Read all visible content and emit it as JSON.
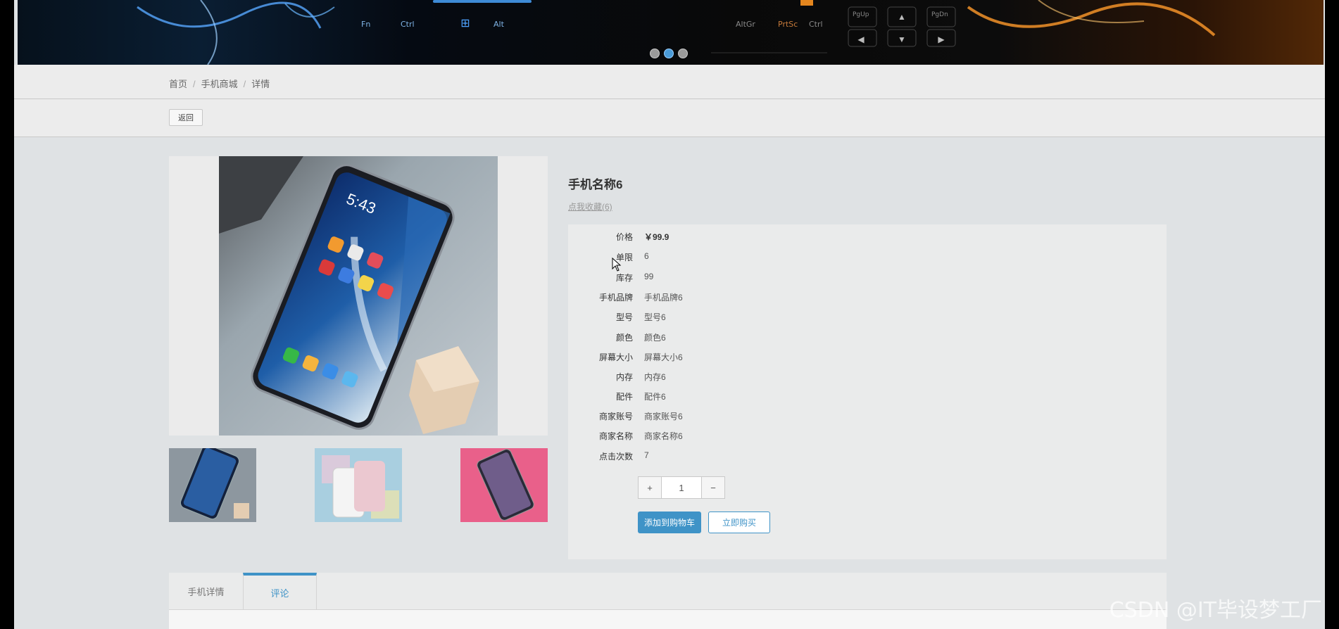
{
  "banner": {
    "keys": [
      "Fn",
      "Ctrl",
      "Alt",
      "AltGr",
      "PrtSc",
      "Ctrl",
      "PgUp",
      "PgDn"
    ]
  },
  "breadcrumb": {
    "home": "首页",
    "shop": "手机商城",
    "current": "详情"
  },
  "back_label": "返回",
  "product": {
    "name": "手机名称6",
    "favorite": "点我收藏(6)",
    "attributes": [
      {
        "label": "价格",
        "value": "￥99.9"
      },
      {
        "label": "单限",
        "value": "6"
      },
      {
        "label": "库存",
        "value": "99"
      },
      {
        "label": "手机品牌",
        "value": "手机品牌6"
      },
      {
        "label": "型号",
        "value": "型号6"
      },
      {
        "label": "颜色",
        "value": "颜色6"
      },
      {
        "label": "屏幕大小",
        "value": "屏幕大小6"
      },
      {
        "label": "内存",
        "value": "内存6"
      },
      {
        "label": "配件",
        "value": "配件6"
      },
      {
        "label": "商家账号",
        "value": "商家账号6"
      },
      {
        "label": "商家名称",
        "value": "商家名称6"
      },
      {
        "label": "点击次数",
        "value": "7"
      }
    ],
    "quantity": "1",
    "plus": "+",
    "minus": "−",
    "add_cart": "添加到购物车",
    "buy_now": "立即购买"
  },
  "tabs": [
    "手机详情",
    "评论"
  ],
  "watermark": "CSDN @IT毕设梦工厂"
}
